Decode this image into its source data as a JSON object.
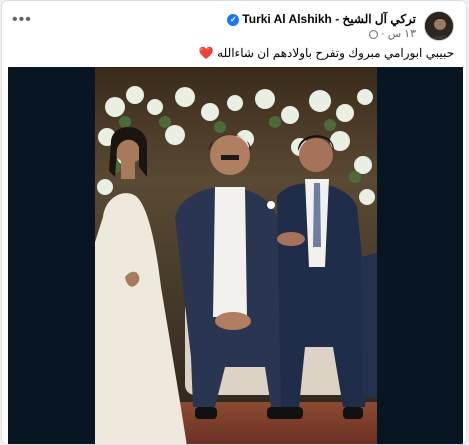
{
  "post": {
    "author": "تركي آل الشيخ - Turki Al Alshikh",
    "time": "١٣ س",
    "more_label": "•••",
    "caption": "حبيبي ابورامي مبروك وتفرح باولادهم ان شاءالله",
    "heart": "❤️"
  },
  "colors": {
    "accent": "#1877f2",
    "media_background": "#081624"
  }
}
